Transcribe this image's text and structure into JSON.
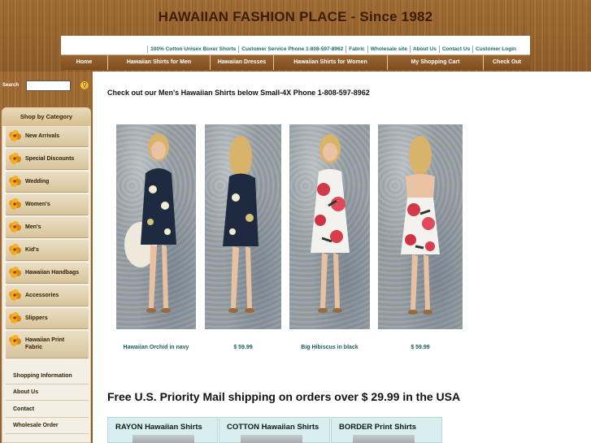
{
  "site": {
    "title": "HAWAIIAN FASHION PLACE - Since 1982"
  },
  "top_links": [
    "100% Cotton Unisex Boxer Shorts",
    "Customer Service Phone 1-808-597-8962",
    "Fabric",
    "Wholesale site",
    "About Us",
    "Contact Us",
    "Customer Login"
  ],
  "nav": [
    "Home",
    "Hawaiian Shirts for Men",
    "Hawaiian Dresses",
    "Hawaiian Shirts for Women",
    "My Shopping Cart",
    "Check Out"
  ],
  "search": {
    "label": "Search",
    "value": "",
    "button_icon": "search-magnifier-icon"
  },
  "sidebar": {
    "category_title": "Shop by Category",
    "categories": [
      "New Arrivals",
      "Special Discounts",
      "Wedding",
      "Women's",
      "Men's",
      "Kid's",
      "Hawaiian Handbags",
      "Accessories",
      "Slippers",
      "Hawaiian Print Fabric"
    ],
    "category_icon": "hibiscus-icon",
    "info_links": [
      "Shopping Information",
      "About Us",
      "Contact",
      "Wholesale Order"
    ]
  },
  "main": {
    "intro": "Check out our Men's Hawaiian Shirts below Small-4X Phone 1-808-597-8962",
    "products": [
      {
        "caption": "Hawaiian Orchid in navy"
      },
      {
        "caption": "$ 59.99"
      },
      {
        "caption": "Big Hibiscus in black"
      },
      {
        "caption": "$ 59.99"
      }
    ],
    "free_shipping": "Free U.S. Priority Mail shipping on orders over $ 29.99 in the USA",
    "category_boxes": [
      "RAYON Hawaiian Shirts",
      "COTTON Hawaiian Shirts",
      "BORDER Print Shirts"
    ]
  },
  "colors": {
    "wood": "#8a5a2b",
    "link_teal": "#1b5e5e",
    "box_bg": "#d9eeee"
  }
}
